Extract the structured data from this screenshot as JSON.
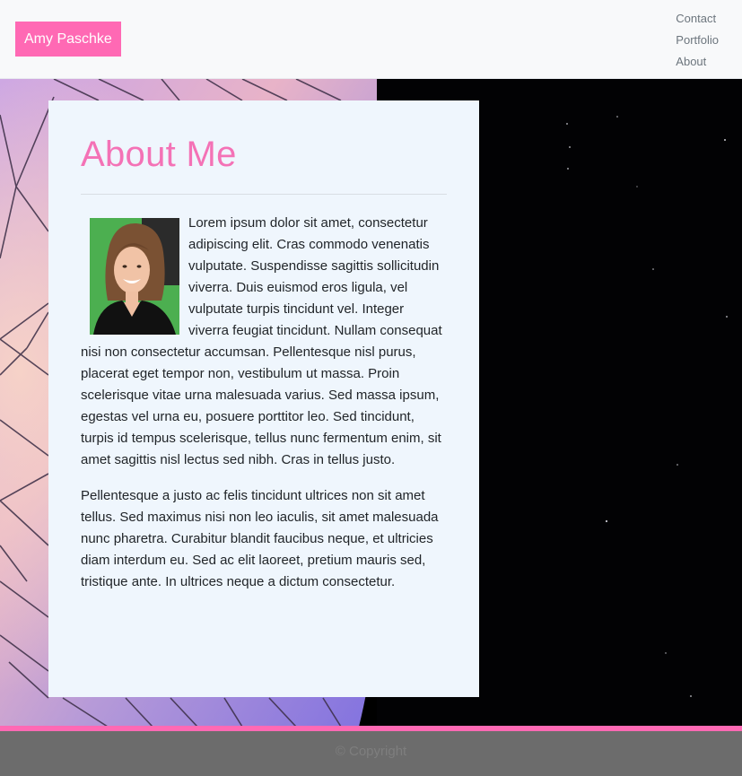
{
  "header": {
    "brand": "Amy Paschke",
    "nav": [
      {
        "label": "Contact"
      },
      {
        "label": "Portfolio"
      },
      {
        "label": "About"
      }
    ]
  },
  "colors": {
    "accent": "#ff69b4",
    "heading": "#f472b6",
    "card_bg": "#eff6fd",
    "footer_bg": "#6c6c6c"
  },
  "main": {
    "title": "About Me",
    "paragraphs": [
      "Lorem ipsum dolor sit amet, consectetur adipiscing elit. Cras commodo venenatis vulputate. Suspendisse sagittis sollicitudin viverra. Duis euismod eros ligula, vel vulputate turpis tincidunt vel. Integer viverra feugiat tincidunt. Nullam consequat nisi non consectetur accumsan. Pellentesque nisl purus, placerat eget tempor non, vestibulum ut massa. Proin scelerisque vitae urna malesuada varius. Sed massa ipsum, egestas vel urna eu, posuere porttitor leo. Sed tincidunt, turpis id tempus scelerisque, tellus nunc fermentum enim, sit amet sagittis nisl lectus sed nibh. Cras in tellus justo.",
      "Pellentesque a justo ac felis tincidunt ultrices non sit amet tellus. Sed maximus nisi non leo iaculis, sit amet malesuada nunc pharetra. Curabitur blandit faucibus neque, et ultricies diam interdum eu. Sed ac elit laoreet, pretium mauris sed, tristique ante. In ultrices neque a dictum consectetur."
    ]
  },
  "footer": {
    "copyright": "© Copyright"
  }
}
